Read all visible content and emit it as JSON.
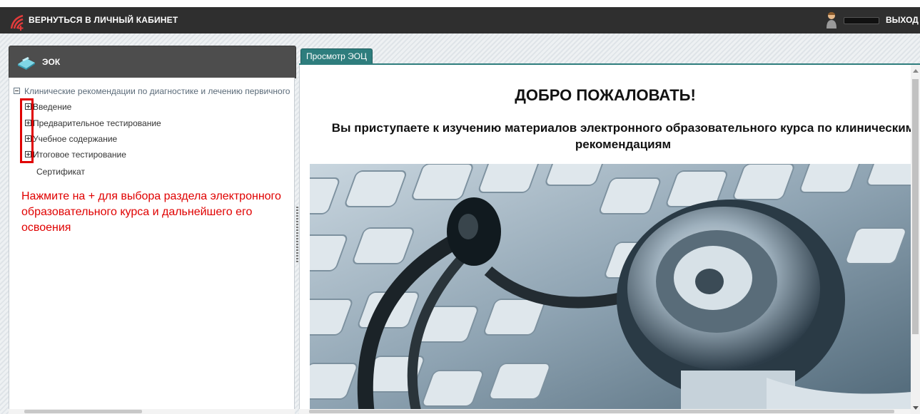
{
  "topbar": {
    "back_label": "ВЕРНУТЬСЯ В ЛИЧНЫЙ КАБИНЕТ",
    "logout_label": "ВЫХОД"
  },
  "sidebar": {
    "title": "ЭОК",
    "root_label": "Клинические рекомендации по диагностике и лечению первичного",
    "items": [
      {
        "label": "Введение"
      },
      {
        "label": "Предварительное тестирование"
      },
      {
        "label": "Учебное содержание"
      },
      {
        "label": "Итоговое тестирование"
      }
    ],
    "leaf_label": "Сертификат",
    "hint": "Нажмите на  +  для выбора раздела электронного образовательного курса и дальнейшего его освоения"
  },
  "main": {
    "tab_label": "Просмотр ЭОЦ",
    "welcome": "ДОБРО ПОЖАЛОВАТЬ!",
    "intro": "Вы приступаете к изучению материалов электронного образовательного курса по клиническим рекомендациям"
  },
  "colors": {
    "topbar": "#2f2f2f",
    "tab": "#2e7d7d",
    "hint": "#e00000",
    "highlight": "#e00000"
  },
  "icons": [
    "app-logo-icon",
    "user-avatar-icon",
    "book-icon",
    "collapse-icon",
    "expand-icon",
    "stethoscope-image"
  ]
}
